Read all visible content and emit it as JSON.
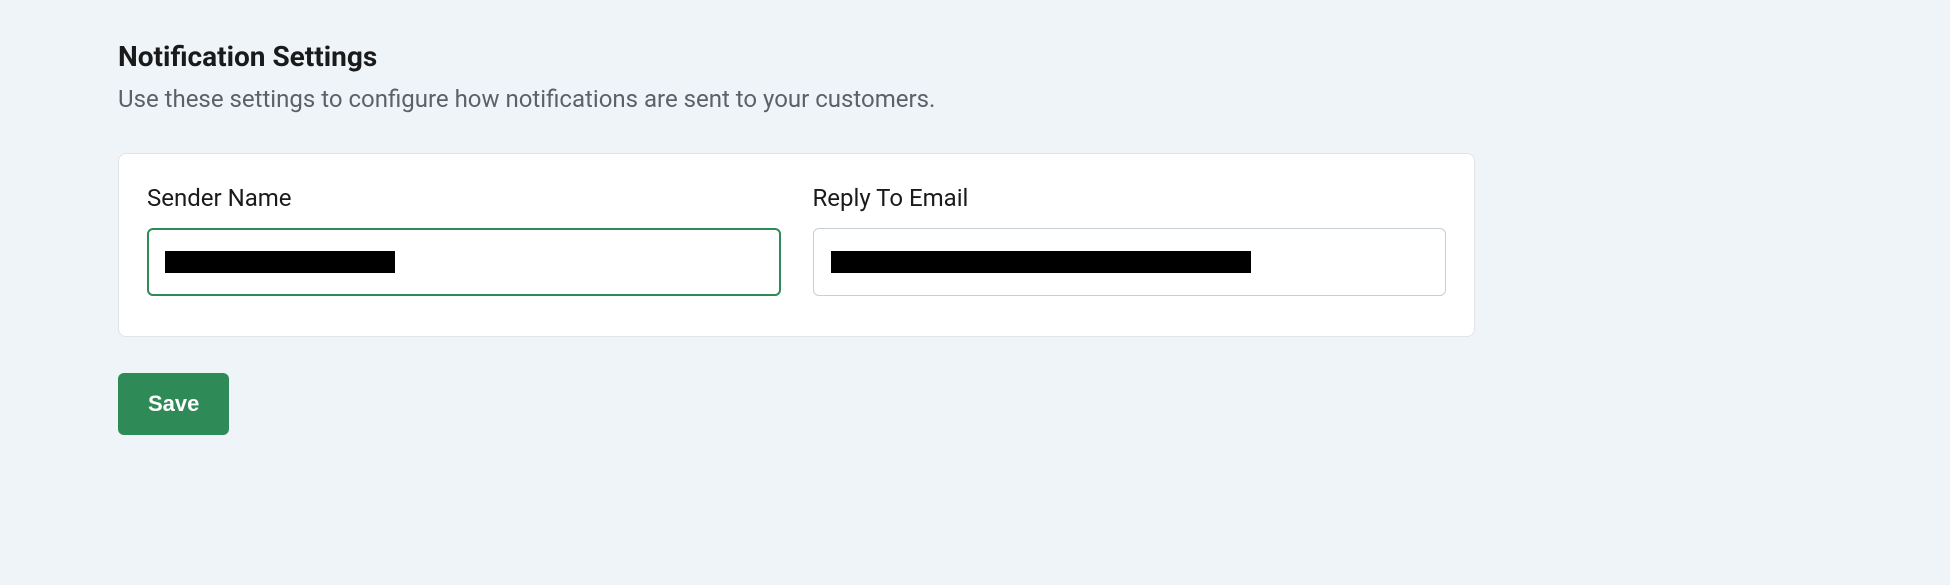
{
  "section": {
    "title": "Notification Settings",
    "description": "Use these settings to configure how notifications are sent to your customers."
  },
  "form": {
    "sender_name_label": "Sender Name",
    "sender_name_value": "",
    "reply_to_label": "Reply To Email",
    "reply_to_value": ""
  },
  "actions": {
    "save_label": "Save"
  }
}
